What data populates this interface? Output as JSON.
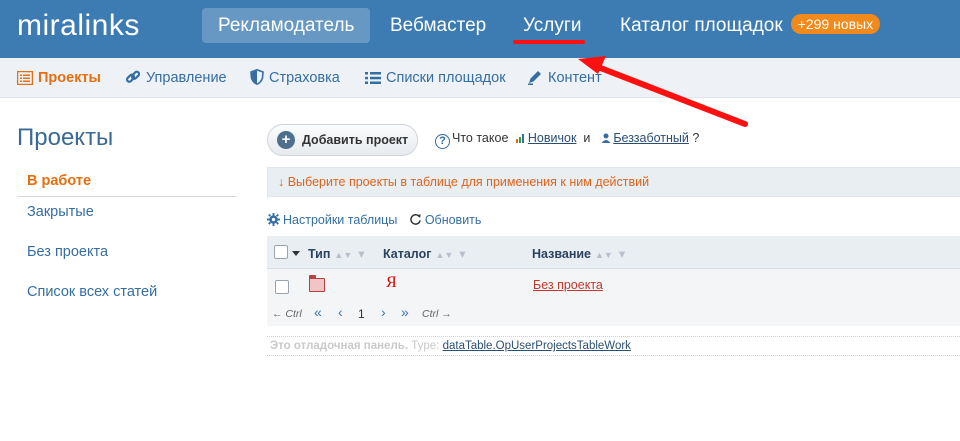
{
  "header": {
    "logo": "miralinks",
    "nav": [
      {
        "label": "Рекламодатель",
        "active": true
      },
      {
        "label": "Вебмастер",
        "active": false
      },
      {
        "label": "Услуги",
        "active": false
      },
      {
        "label": "Каталог площадок",
        "active": false
      }
    ],
    "catalog_badge": "+299 новых"
  },
  "subnav": {
    "items": [
      {
        "label": "Проекты",
        "icon": "list-icon",
        "active": true
      },
      {
        "label": "Управление",
        "icon": "link-icon",
        "active": false
      },
      {
        "label": "Страховка",
        "icon": "shield-icon",
        "active": false
      },
      {
        "label": "Списки площадок",
        "icon": "bullet-list-icon",
        "active": false
      },
      {
        "label": "Контент",
        "icon": "pen-icon",
        "active": false
      }
    ]
  },
  "sidebar": {
    "title": "Проекты",
    "items": [
      {
        "label": "В работе",
        "active": true
      },
      {
        "label": "Закрытые",
        "active": false
      },
      {
        "label": "Без проекта",
        "active": false
      },
      {
        "label": "Список всех статей",
        "active": false
      }
    ]
  },
  "main": {
    "add_button": "Добавить проект",
    "help": {
      "prefix": "Что такое",
      "link1": "Новичок",
      "conj": "и",
      "link2": "Беззаботный",
      "suffix": "?"
    },
    "notice": "↓  Выберите проекты в таблице для применения к ним действий",
    "tools": {
      "settings": "Настройки таблицы",
      "refresh": "Обновить"
    },
    "table": {
      "columns": [
        "Тип",
        "Каталог",
        "Название"
      ],
      "rows": [
        {
          "type_icon": "folder-icon",
          "catalog": "Я",
          "name": "Без проекта"
        }
      ]
    },
    "pager": {
      "prev_hint": "← Ctrl",
      "first": "«",
      "prev": "‹",
      "current": "1",
      "next": "›",
      "last": "»",
      "next_hint": "Ctrl →"
    },
    "debug": {
      "label": "Это отладочная панель.",
      "type_label": "Type:",
      "type_value": "dataTable.OpUserProjectsTableWork"
    }
  },
  "colors": {
    "header_bg": "#3d7cb2",
    "accent_orange": "#e56f10",
    "link_blue": "#356ea3",
    "annotation_red": "#ff1010"
  }
}
